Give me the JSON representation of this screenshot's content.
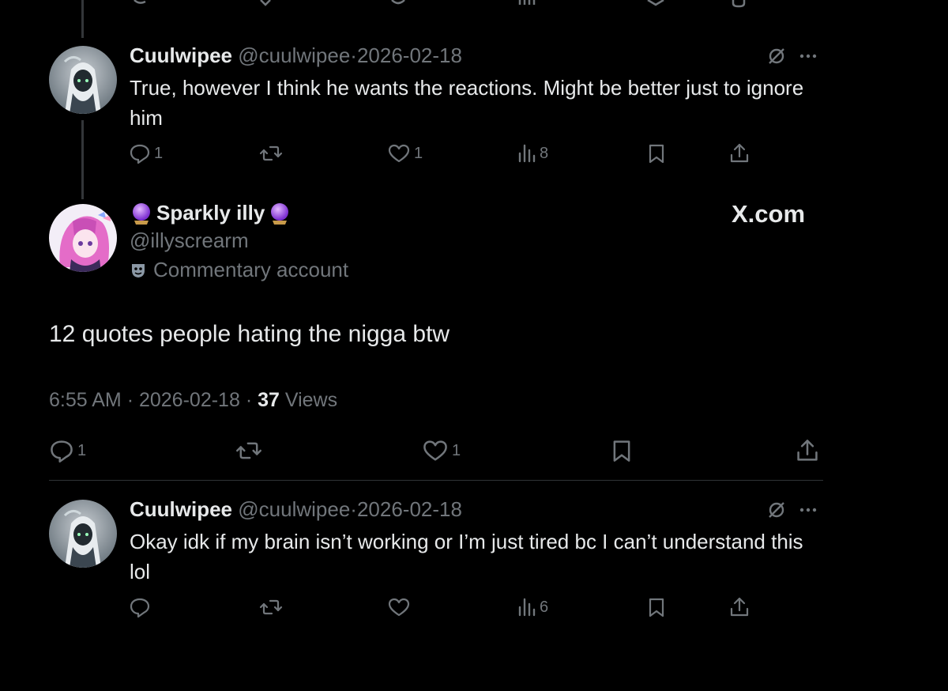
{
  "replies": [
    {
      "name": "Cuulwipee",
      "handle": "@cuulwipee",
      "sep": "·",
      "date": "2026-02-18",
      "text": "True, however I think he wants the reactions. Might be better just to ignore him",
      "replies": "1",
      "reposts": "",
      "likes": "1",
      "views": "8"
    },
    {
      "name": "Cuulwipee",
      "handle": "@cuulwipee",
      "sep": "·",
      "date": "2026-02-18",
      "text": "Okay idk if my brain isn’t working or I’m just tired bc I can’t understand this lol",
      "replies": "",
      "reposts": "",
      "likes": "",
      "views": "6"
    }
  ],
  "main_post": {
    "name": "Sparkly illy",
    "handle": "@illyscrearm",
    "affiliation": "Commentary account",
    "text": "12 quotes people hating the nigga btw",
    "time": "6:55 AM",
    "sep": "·",
    "date": "2026-02-18",
    "views_count": "37",
    "views_label": "Views",
    "replies": "1",
    "likes": "1"
  },
  "watermark": "X.com",
  "colors": {
    "background": "#000000",
    "text": "#e7e9ea",
    "muted": "#71767b",
    "divider": "#2f3336"
  }
}
